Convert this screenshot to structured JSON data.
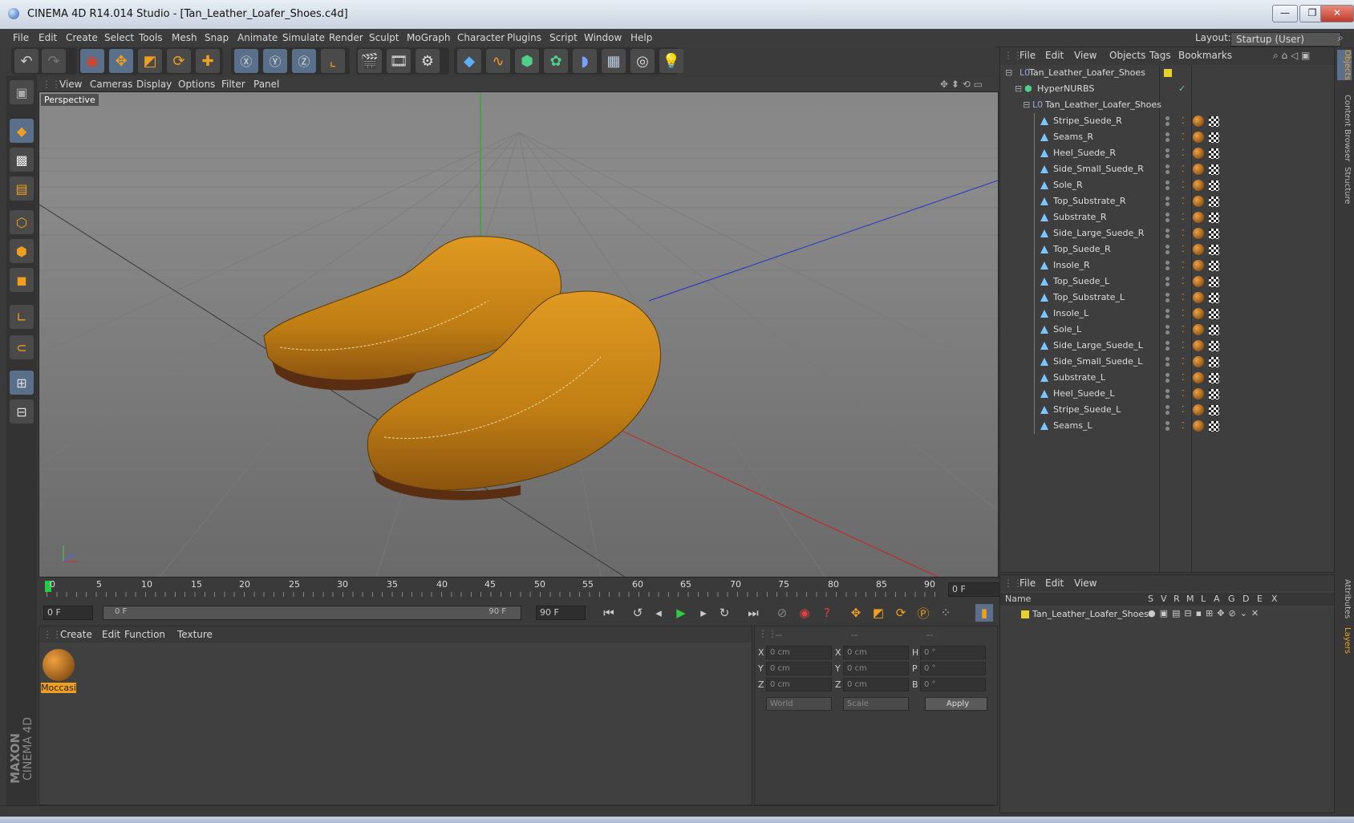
{
  "window": {
    "title": "CINEMA 4D R14.014 Studio - [Tan_Leather_Loafer_Shoes.c4d]"
  },
  "menubar": {
    "items": [
      "File",
      "Edit",
      "Create",
      "Select",
      "Tools",
      "Mesh",
      "Snap",
      "Animate",
      "Simulate",
      "Render",
      "Sculpt",
      "MoGraph",
      "Character",
      "Plugins",
      "Script",
      "Window",
      "Help"
    ],
    "layout_label": "Layout:",
    "layout_value": "Startup (User)"
  },
  "viewport": {
    "menu": [
      "View",
      "Cameras",
      "Display",
      "Options",
      "Filter",
      "Panel"
    ],
    "camera_label": "Perspective"
  },
  "timeline": {
    "ticks": [
      "0",
      "5",
      "10",
      "15",
      "20",
      "25",
      "30",
      "35",
      "40",
      "45",
      "50",
      "55",
      "60",
      "65",
      "70",
      "75",
      "80",
      "85",
      "90"
    ],
    "frame_field": "0 F"
  },
  "transport": {
    "start_field": "0 F",
    "range_start": "0 F",
    "range_end": "90 F",
    "end_field": "90 F"
  },
  "materials": {
    "menu": [
      "Create",
      "Edit",
      "Function",
      "Texture"
    ],
    "items": [
      {
        "name": "Moccasi"
      }
    ]
  },
  "coordinates": {
    "headers": [
      "--",
      "--",
      "--"
    ],
    "rows": [
      {
        "a": "X",
        "av": "0 cm",
        "b": "X",
        "bv": "0 cm",
        "c": "H",
        "cv": "0 °"
      },
      {
        "a": "Y",
        "av": "0 cm",
        "b": "Y",
        "bv": "0 cm",
        "c": "P",
        "cv": "0 °"
      },
      {
        "a": "Z",
        "av": "0 cm",
        "b": "Z",
        "bv": "0 cm",
        "c": "B",
        "cv": "0 °"
      }
    ],
    "mode_select": "World",
    "scale_select": "Scale",
    "apply_label": "Apply"
  },
  "objects": {
    "menu": [
      "File",
      "Edit",
      "View",
      "Objects",
      "Tags",
      "Bookmarks"
    ],
    "root": "Tan_Leather_Loafer_Shoes",
    "hypernurbs": "HyperNURBS",
    "group": "Tan_Leather_Loafer_Shoes",
    "children": [
      "Stripe_Suede_R",
      "Seams_R",
      "Heel_Suede_R",
      "Side_Small_Suede_R",
      "Sole_R",
      "Top_Substrate_R",
      "Substrate_R",
      "Side_Large_Suede_R",
      "Top_Suede_R",
      "Insole_R",
      "Top_Suede_L",
      "Top_Substrate_L",
      "Insole_L",
      "Sole_L",
      "Side_Large_Suede_L",
      "Side_Small_Suede_L",
      "Substrate_L",
      "Heel_Suede_L",
      "Stripe_Suede_L",
      "Seams_L"
    ]
  },
  "layers": {
    "menu": [
      "File",
      "Edit",
      "View"
    ],
    "columns": [
      "Name",
      "S",
      "V",
      "R",
      "M",
      "L",
      "A",
      "G",
      "D",
      "E",
      "X"
    ],
    "rows": [
      {
        "name": "Tan_Leather_Loafer_Shoes",
        "color": "#e8d22a"
      }
    ]
  },
  "right_tabs": [
    "Objects",
    "Content Browser",
    "Structure",
    "Attributes",
    "Layers"
  ],
  "brand": {
    "line1": "MAXON",
    "line2": "CINEMA 4D"
  },
  "colors": {
    "accent": "#f0a020",
    "shoe": "#c98a1c",
    "ui_bg": "#3a3a3a"
  }
}
